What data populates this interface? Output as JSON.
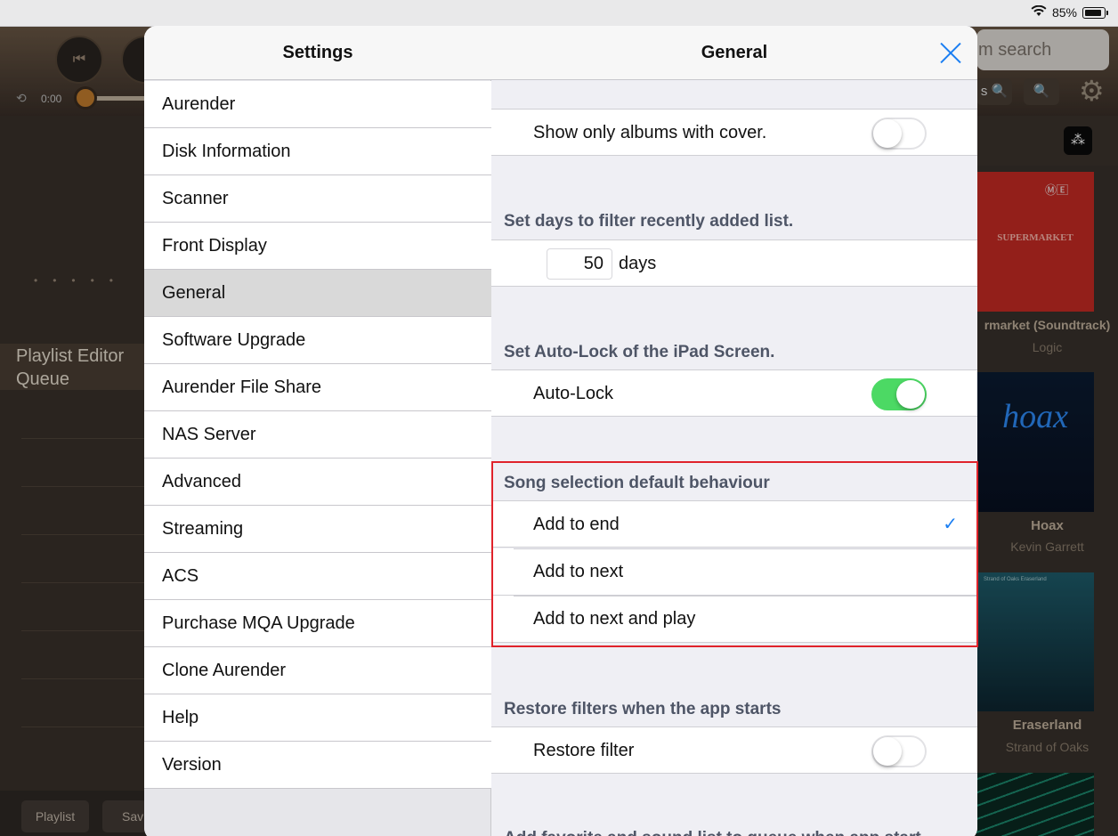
{
  "status": {
    "battery": "85%",
    "battery_level": 0.85
  },
  "background": {
    "time": "0:00",
    "playlist_editor": "Playlist Editor",
    "queue": "Queue",
    "playlist_button": "Playlist",
    "save_button": "Sav",
    "search_placeholder": "m search",
    "albums": [
      {
        "art": "SUPERMARKET",
        "title": "rmarket (Soundtrack)",
        "artist": "Logic"
      },
      {
        "art": "hoax",
        "title": "Hoax",
        "artist": "Kevin Garrett"
      },
      {
        "art": "Strand of Oaks   Eraserland",
        "title": "Eraserland",
        "artist": "Strand of Oaks"
      }
    ]
  },
  "settings": {
    "title": "Settings",
    "items": [
      {
        "label": "Aurender"
      },
      {
        "label": "Disk Information"
      },
      {
        "label": "Scanner"
      },
      {
        "label": "Front Display"
      },
      {
        "label": "General"
      },
      {
        "label": "Software Upgrade"
      },
      {
        "label": "Aurender File Share"
      },
      {
        "label": "NAS Server"
      },
      {
        "label": "Advanced"
      },
      {
        "label": "Streaming"
      },
      {
        "label": "ACS"
      },
      {
        "label": "Purchase MQA Upgrade"
      },
      {
        "label": "Clone Aurender"
      },
      {
        "label": "Help"
      },
      {
        "label": "Version"
      }
    ],
    "selected_index": 4
  },
  "general": {
    "title": "General",
    "show_albums_cover": {
      "label": "Show only albums with cover.",
      "enabled": false
    },
    "recent": {
      "header": "Set days to filter recently added list.",
      "days_value": "50",
      "days_label": "days"
    },
    "autolock": {
      "header": "Set Auto-Lock of the iPad Screen.",
      "label": "Auto-Lock",
      "enabled": true
    },
    "song_selection": {
      "header": "Song selection default behaviour",
      "options": [
        {
          "label": "Add to end",
          "selected": true
        },
        {
          "label": "Add to next",
          "selected": false
        },
        {
          "label": "Add to next and play",
          "selected": false
        }
      ]
    },
    "restore": {
      "header": "Restore filters when the app starts",
      "label": "Restore filter",
      "enabled": false
    },
    "next_header": "Add favorite and sound list to queue when app start"
  }
}
